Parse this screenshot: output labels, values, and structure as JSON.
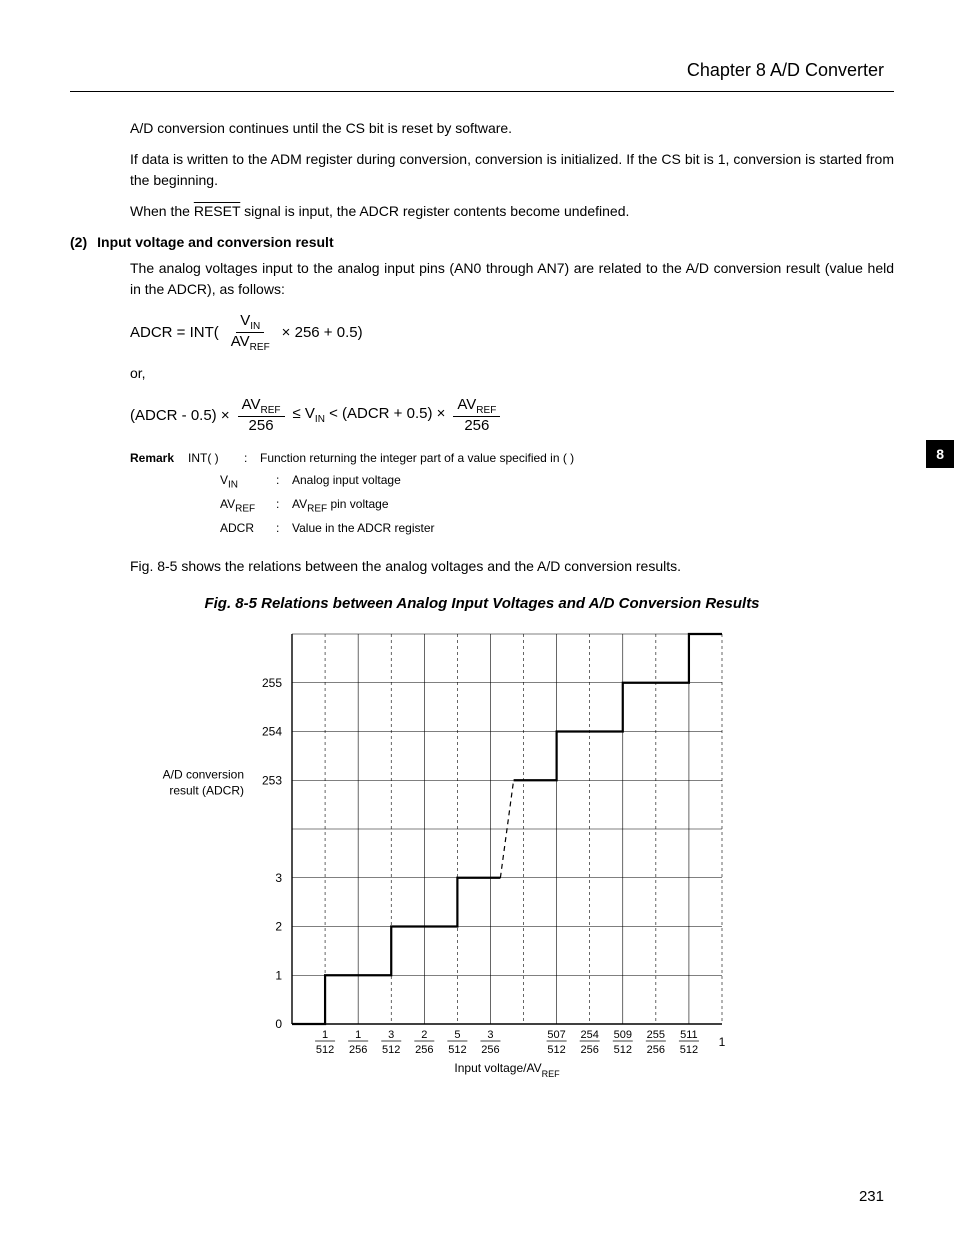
{
  "header": {
    "chapter": "Chapter 8   A/D Converter"
  },
  "body": {
    "p1": "A/D conversion continues until the CS bit is reset by software.",
    "p2": "If data is written to the ADM register during conversion, conversion is initialized.  If the CS bit is 1, conversion is started from the beginning.",
    "p3a": "When the ",
    "p3_reset": "RESET",
    "p3b": " signal is input, the ADCR register contents become undefined.",
    "section_num": "(2)",
    "section_title": "Input voltage and conversion result",
    "p4": "The analog voltages input to the analog input pins (AN0 through AN7) are related to the A/D conversion result (value held in the ADCR), as follows:",
    "or": "or,",
    "p5": "Fig. 8-5 shows the relations between the analog voltages and the A/D conversion results."
  },
  "formula1": {
    "lhs": "ADCR = INT(",
    "num": "V",
    "num_sub": "IN",
    "den": "AV",
    "den_sub": "REF",
    "tail": " × 256 + 0.5)"
  },
  "formula2": {
    "a": "(ADCR - 0.5) ×",
    "num1": "AV",
    "num1_sub": "REF",
    "den1": "256",
    "b": " ≤ V",
    "b_sub": "IN",
    "c": " < (ADCR + 0.5) ×",
    "num2": "AV",
    "num2_sub": "REF",
    "den2": "256"
  },
  "remark": {
    "label": "Remark",
    "r1_term": "INT( )",
    "r1_colon": ":",
    "r1_desc": "Function returning the integer part of a value specified in ( )",
    "r2_term": "V",
    "r2_sub": "IN",
    "r2_colon": ":",
    "r2_desc": "Analog input voltage",
    "r3_term": "AV",
    "r3_sub": "REF",
    "r3_colon": ":",
    "r3_desc": "AV",
    "r3_desc_sub": "REF",
    "r3_desc2": " pin voltage",
    "r4_term": "ADCR",
    "r4_colon": ":",
    "r4_desc": "Value in the ADCR register"
  },
  "figure": {
    "caption": "Fig. 8-5  Relations between Analog Input Voltages and A/D Conversion Results"
  },
  "side_tab": "8",
  "page_number": "231",
  "chart_data": {
    "type": "step",
    "title": "Relations between Analog Input Voltages and A/D Conversion Results",
    "ylabel": "A/D conversion result (ADCR)",
    "xlabel": "Input voltage/AVREF",
    "y_ticks": [
      "0",
      "1",
      "2",
      "3",
      "253",
      "254",
      "255"
    ],
    "x_ticks": [
      {
        "num": "1",
        "den": "512"
      },
      {
        "num": "1",
        "den": "256"
      },
      {
        "num": "3",
        "den": "512"
      },
      {
        "num": "2",
        "den": "256"
      },
      {
        "num": "5",
        "den": "512"
      },
      {
        "num": "3",
        "den": "256"
      },
      {
        "num": "507",
        "den": "512"
      },
      {
        "num": "254",
        "den": "256"
      },
      {
        "num": "509",
        "den": "512"
      },
      {
        "num": "255",
        "den": "256"
      },
      {
        "num": "511",
        "den": "512"
      },
      {
        "num": "1",
        "den": ""
      }
    ],
    "steps": [
      {
        "x_from": "0",
        "x_to": "1/512",
        "y": 0
      },
      {
        "x_from": "1/512",
        "x_to": "3/512",
        "y": 1
      },
      {
        "x_from": "3/512",
        "x_to": "5/512",
        "y": 2
      },
      {
        "x_from": "5/512",
        "x_to": "7/512",
        "y": 3
      },
      {
        "x_from": "505/512",
        "x_to": "507/512",
        "y": 253
      },
      {
        "x_from": "507/512",
        "x_to": "509/512",
        "y": 254
      },
      {
        "x_from": "509/512",
        "x_to": "1",
        "y": 255
      }
    ],
    "ylim": [
      0,
      256
    ],
    "xlim": [
      0,
      1
    ]
  }
}
